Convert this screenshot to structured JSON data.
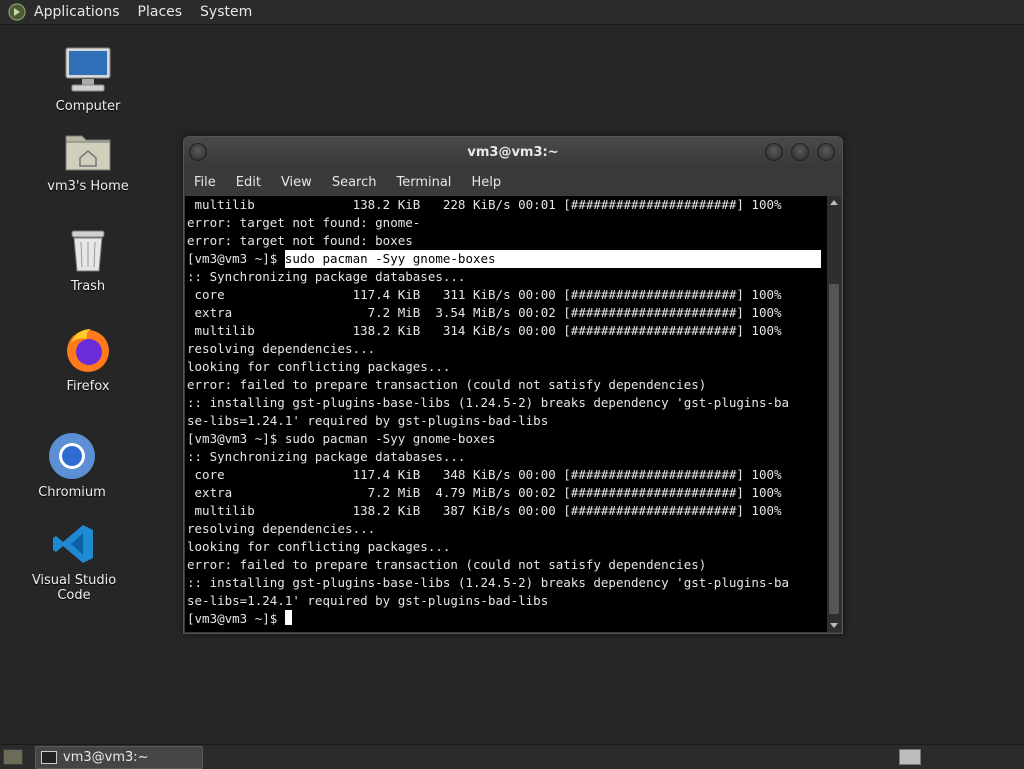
{
  "top_panel": {
    "menus": [
      "Applications",
      "Places",
      "System"
    ]
  },
  "desktop_icons": [
    {
      "label": "Computer",
      "icon": "computer-icon"
    },
    {
      "label": "vm3's Home",
      "icon": "home-folder-icon"
    },
    {
      "label": "Trash",
      "icon": "trash-icon"
    },
    {
      "label": "Firefox",
      "icon": "firefox-icon"
    },
    {
      "label": "Chromium",
      "icon": "chromium-icon"
    },
    {
      "label": "Visual Studio Code",
      "icon": "vscode-icon"
    }
  ],
  "window": {
    "title": "vm3@vm3:~",
    "menu": [
      "File",
      "Edit",
      "View",
      "Search",
      "Terminal",
      "Help"
    ]
  },
  "terminal": {
    "lines": [
      " multilib             138.2 KiB   228 KiB/s 00:01 [######################] 100%",
      "error: target not found: gnome-",
      "error: target not found: boxes",
      "[vm3@vm3 ~]$ ",
      ":: Synchronizing package databases...",
      " core                 117.4 KiB   311 KiB/s 00:00 [######################] 100%",
      " extra                  7.2 MiB  3.54 MiB/s 00:02 [######################] 100%",
      " multilib             138.2 KiB   314 KiB/s 00:00 [######################] 100%",
      "resolving dependencies...",
      "looking for conflicting packages...",
      "error: failed to prepare transaction (could not satisfy dependencies)",
      ":: installing gst-plugins-base-libs (1.24.5-2) breaks dependency 'gst-plugins-ba",
      "se-libs=1.24.1' required by gst-plugins-bad-libs",
      "[vm3@vm3 ~]$ sudo pacman -Syy gnome-boxes",
      ":: Synchronizing package databases...",
      " core                 117.4 KiB   348 KiB/s 00:00 [######################] 100%",
      " extra                  7.2 MiB  4.79 MiB/s 00:02 [######################] 100%",
      " multilib             138.2 KiB   387 KiB/s 00:00 [######################] 100%",
      "resolving dependencies...",
      "looking for conflicting packages...",
      "error: failed to prepare transaction (could not satisfy dependencies)",
      ":: installing gst-plugins-base-libs (1.24.5-2) breaks dependency 'gst-plugins-ba",
      "se-libs=1.24.1' required by gst-plugins-bad-libs",
      "[vm3@vm3 ~]$ "
    ],
    "selected_command": "sudo pacman -Syy gnome-boxes"
  },
  "bottom_panel": {
    "task_label": "vm3@vm3:~"
  }
}
